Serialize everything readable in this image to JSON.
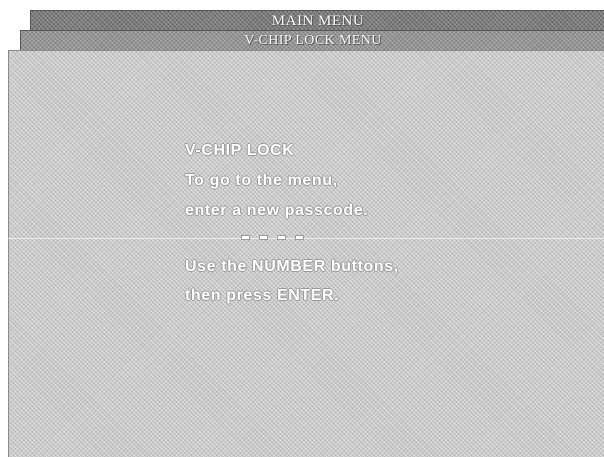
{
  "header": {
    "main_menu_title": "MAIN MENU"
  },
  "submenu": {
    "title": "V-CHIP LOCK MENU"
  },
  "panel": {
    "heading": "V-CHIP LOCK",
    "instruction_line1": "To go to the menu,",
    "instruction_line2": "enter a new passcode.",
    "passcode_slots": 4,
    "hint_line1": "Use the NUMBER buttons,",
    "hint_line2": "then press ENTER."
  },
  "colors": {
    "menu_bar": "#7b7b7b",
    "submenu_bar": "#959595",
    "screen": "#c9c9c9",
    "text": "#ffffff"
  }
}
